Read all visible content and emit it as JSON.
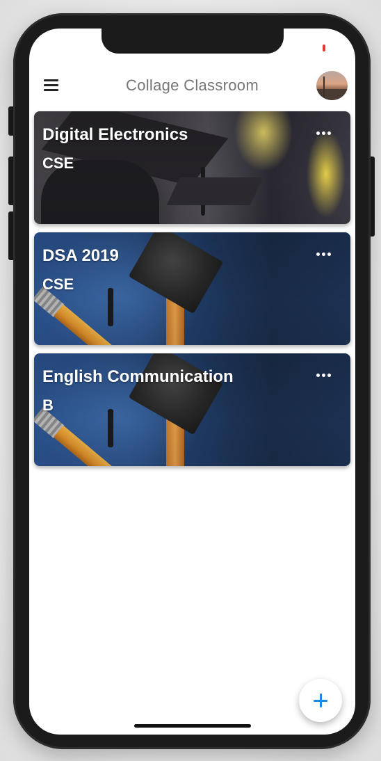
{
  "app": {
    "title": "Collage Classroom"
  },
  "icons": {
    "menu": "hamburger-menu-icon",
    "more": "more-horizontal-icon",
    "add": "plus-icon",
    "avatar": "user-avatar-photo"
  },
  "classes": [
    {
      "name": "Digital Electronics",
      "section": "CSE",
      "theme": "graduation-photo"
    },
    {
      "name": "DSA 2019",
      "section": "CSE",
      "theme": "pencil-cap-photo"
    },
    {
      "name": "English Communication",
      "section": "B",
      "theme": "pencil-cap-photo"
    }
  ],
  "colors": {
    "accent": "#1e88e5",
    "title": "#757575",
    "status_dot": "#e53935"
  }
}
